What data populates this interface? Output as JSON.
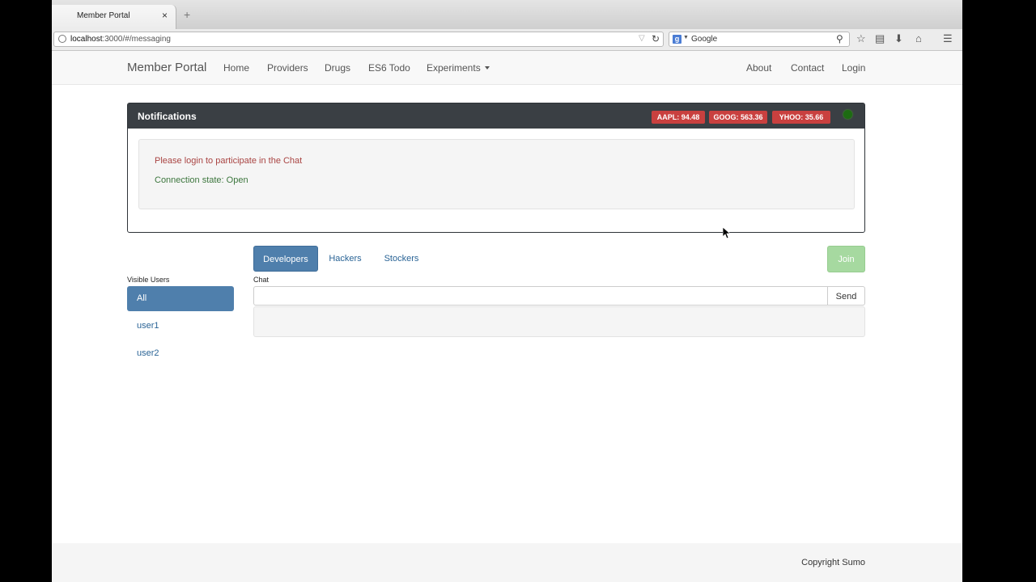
{
  "browser": {
    "tab_title": "Member Portal",
    "tab_close": "×",
    "new_tab": "+",
    "url_host": "localhost",
    "url_rest": ":3000/#/messaging",
    "search_engine": "Google",
    "toolbar_icons": [
      "star-icon",
      "clipboard-icon",
      "download-icon",
      "home-icon",
      "menu-icon"
    ]
  },
  "nav": {
    "brand": "Member Portal",
    "left_links": [
      "Home",
      "Providers",
      "Drugs",
      "ES6 Todo",
      "Experiments"
    ],
    "right_links": [
      "About",
      "Contact",
      "Login"
    ]
  },
  "notifications": {
    "title": "Notifications",
    "stocks": [
      "AAPL: 94.48",
      "GOOG: 563.36",
      "YHOO: 35.66"
    ],
    "status_color": "#1d6b12",
    "login_message": "Please login to participate in the Chat",
    "connection_state": "Connection state: Open"
  },
  "channels": {
    "tabs": [
      "Developers",
      "Hackers",
      "Stockers"
    ],
    "active": "Developers",
    "join_label": "Join"
  },
  "users": {
    "label": "Visible Users",
    "items": [
      "All",
      "user1",
      "user2"
    ],
    "active": "All"
  },
  "chat": {
    "label": "Chat",
    "input_value": "",
    "send_label": "Send"
  },
  "footer": {
    "copyright": "Copyright Sumo"
  },
  "colors": {
    "primary": "#4f7fac",
    "stock_badge": "#c9403f",
    "join_disabled": "#a6d9a0",
    "panel_header": "#3a3f44"
  }
}
